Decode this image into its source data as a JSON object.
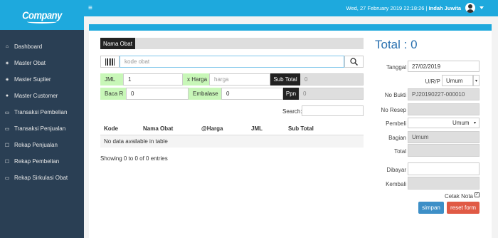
{
  "brand": {
    "name": "Company"
  },
  "sidebar": {
    "items": [
      {
        "label": "Dashboard",
        "icon": "home-icon"
      },
      {
        "label": "Master Obat",
        "icon": "gear-icon"
      },
      {
        "label": "Master Suplier",
        "icon": "gear-icon"
      },
      {
        "label": "Master Customer",
        "icon": "user-icon"
      },
      {
        "label": "Transaksi Pembelian",
        "icon": "card-icon"
      },
      {
        "label": "Transaksi Penjualan",
        "icon": "card-icon"
      },
      {
        "label": "Rekap Penjualan",
        "icon": "edit-icon"
      },
      {
        "label": "Rekap Pembelian",
        "icon": "edit-icon"
      },
      {
        "label": "Rekap Sirkulasi Obat",
        "icon": "card-icon"
      }
    ]
  },
  "topbar": {
    "datetime": "Wed, 27 February 2019 22:18:26",
    "separator": "|",
    "user": "Indah Juwita"
  },
  "form": {
    "nama_obat_label": "Nama Obat",
    "kode_placeholder": "kode obat",
    "jml_label": "JML",
    "jml_value": "1",
    "xharga_label": "x Harga",
    "harga_placeholder": "harga",
    "subtotal_label": "Sub Total",
    "subtotal_value": "0",
    "bacar_label": "Baca R",
    "bacar_value": "0",
    "embalase_label": "Embalase",
    "embalase_value": "0",
    "ppn_label": "Ppn",
    "ppn_value": "0"
  },
  "table": {
    "search_label": "Search:",
    "columns": [
      "Kode",
      "Nama Obat",
      "@Harga",
      "JML",
      "Sub Total"
    ],
    "empty_text": "No data available in table",
    "info": "Showing 0 to 0 of 0 entries"
  },
  "summary": {
    "total_title": "Total : 0",
    "tanggal_label": "Tanggal",
    "tanggal_value": "27/02/2019",
    "urp_label": "U/R/P",
    "urp_value": "Umum",
    "nobukti_label": "No Bukti",
    "nobukti_value": "PJ20190227-000010",
    "noresep_label": "No Resep",
    "pembeli_label": "Pembeli",
    "pembeli_value": "Umum",
    "bagian_label": "Bagian",
    "bagian_value": "Umum",
    "total_label": "Total",
    "dibayar_label": "Dibayar",
    "kembali_label": "Kembali",
    "cetak_label": "Cetak Nota",
    "simpan_label": "simpan",
    "reset_label": "reset form"
  },
  "colors": {
    "accent": "#1ea9dd",
    "sidebar": "#2a3f54",
    "green": "#c8f7b8",
    "simpan": "#3d8fc7",
    "reset": "#e05a45"
  }
}
